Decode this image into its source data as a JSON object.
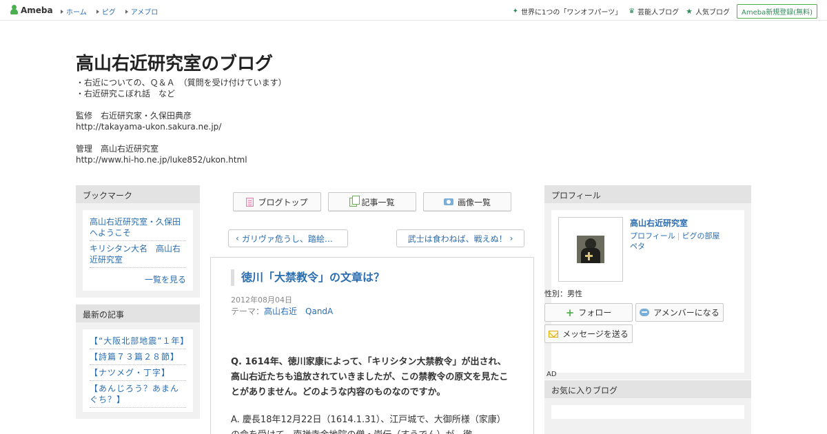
{
  "topbar": {
    "logo": "Ameba",
    "nav": [
      "ホーム",
      "ピグ",
      "アメブロ"
    ],
    "right_links": [
      "世界に1つの「ワンオフパーツ」",
      "芸能人ブログ",
      "人気ブログ"
    ],
    "register": "Ameba新規登録(無料)"
  },
  "header": {
    "title": "高山右近研究室のブログ",
    "desc_lines": [
      "・右近についての、Ｑ＆Ａ　（質問を受け付けています）",
      "・右近研究こぼれ話　など",
      "",
      "監修　右近研究家・久保田典彦",
      "http://takayama-ukon.sakura.ne.jp/",
      "",
      "管理　高山右近研究室",
      "http://www.hi-ho.ne.jp/luke852/ukon.html"
    ]
  },
  "bookmarks": {
    "heading": "ブックマーク",
    "items": [
      "高山右近研究室・久保田へようこそ",
      "キリシタン大名　高山右近研究室"
    ],
    "more": "一覧を見る"
  },
  "recent": {
    "heading": "最新の記事",
    "items": [
      "【“大阪北部地震”１年】",
      "【詩篇７３篇２８節】",
      "【ナツメグ・丁字】",
      "【あんじろう？あまんぐち？】"
    ]
  },
  "tabs": [
    "ブログトップ",
    "記事一覧",
    "画像一覧"
  ],
  "pager": {
    "prev": "ガリヴァ危うし、踏絵…",
    "next": "武士は食わねば、戦えぬ！"
  },
  "article": {
    "title": "徳川「大禁教令」の文章は？",
    "date": "2012年08月04日",
    "theme_label": "テーマ：",
    "theme": "高山右近　QandA",
    "question": "Q. 1614年、徳川家康によって、「キリシタン大禁教令」が出され、高山右近たちも追放されていきましたが、この禁教令の原文を見たことがありません。どのような内容のものなのですか。",
    "answer": "A. 慶長18年12月22日（1614.1.31）、江戸城で、大御所様（家康）の命を受けて、南禅寺金地院の僧・崇伝（すうでん）が、徹"
  },
  "profile": {
    "heading": "プロフィール",
    "name": "高山右近研究室",
    "link_profile": "プロフィール",
    "link_room": "ピグの部屋",
    "link_peta": "ペタ",
    "gender": "性別：男性",
    "follow": "フォロー",
    "member": "アメンバーになる",
    "message": "メッセージを送る"
  },
  "ad": "AD",
  "favorites": {
    "heading": "お気に入りブログ"
  },
  "colors": {
    "link": "#2a6db0",
    "brand": "#4caf50",
    "panel": "#f1f1f1",
    "panel_head": "#e3e3e3"
  }
}
